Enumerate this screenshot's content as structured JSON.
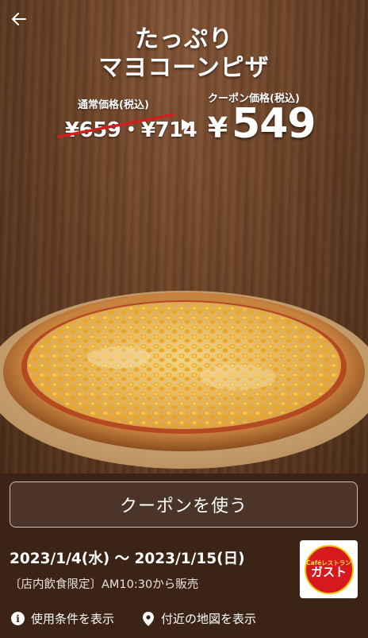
{
  "header": {
    "title_line1": "たっぷり",
    "title_line2": "マヨコーンピザ"
  },
  "price": {
    "regular_label": "通常価格(税込)",
    "regular_value": "¥659・¥714",
    "coupon_label": "クーポン価格(税込)",
    "coupon_currency": "¥",
    "coupon_value": "549"
  },
  "actions": {
    "use_coupon": "クーポンを使う",
    "terms": "使用条件を表示",
    "map": "付近の地図を表示"
  },
  "period": {
    "dates": "2023/1/4(水) 〜 2023/1/15(日)",
    "note": "〔店内飲食限定〕AM10:30から販売"
  },
  "logo": {
    "small": "Caféレストラン",
    "main": "ガスト"
  },
  "colors": {
    "strike": "#d01f1f",
    "logo_red": "#d6181f",
    "logo_yellow": "#f0c400",
    "panel": "#3b2416"
  },
  "icons": {
    "back": "arrow-left-icon",
    "info": "info-icon",
    "pin": "map-pin-icon"
  }
}
